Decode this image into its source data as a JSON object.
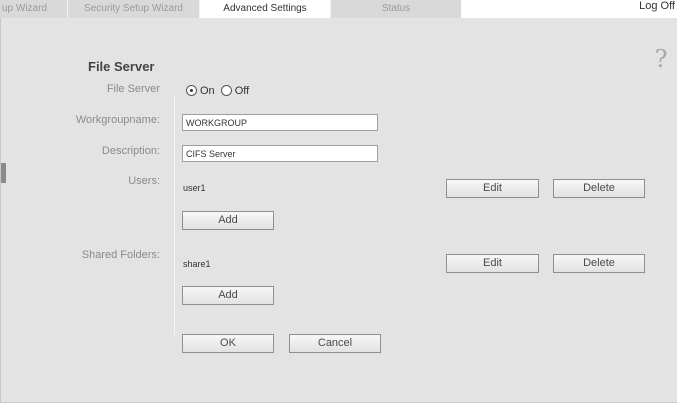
{
  "tabs": [
    {
      "label": "up Wizard",
      "active": false
    },
    {
      "label": "Security Setup Wizard",
      "active": false
    },
    {
      "label": "Advanced Settings",
      "active": true
    },
    {
      "label": "Status",
      "active": false
    }
  ],
  "header": {
    "logoff_label": "Log Off",
    "help_icon": "help-question-icon",
    "help_glyph": "?"
  },
  "page": {
    "title": "File Server"
  },
  "form": {
    "file_server": {
      "label": "File Server",
      "options": [
        "On",
        "Off"
      ],
      "selected": "On"
    },
    "workgroup": {
      "label": "Workgroupname:",
      "value": "WORKGROUP"
    },
    "description": {
      "label": "Description:",
      "value": "CIFS Server"
    },
    "users": {
      "label": "Users:",
      "items": [
        {
          "name": "user1",
          "edit_label": "Edit",
          "delete_label": "Delete"
        }
      ],
      "add_label": "Add"
    },
    "shared_folders": {
      "label": "Shared Folders:",
      "items": [
        {
          "name": "share1",
          "edit_label": "Edit",
          "delete_label": "Delete"
        }
      ],
      "add_label": "Add"
    }
  },
  "actions": {
    "ok_label": "OK",
    "cancel_label": "Cancel"
  },
  "colors": {
    "panel_bg": "#e3e3e3",
    "tab_inactive_bg": "#d9d9d9",
    "tab_active_bg": "#ffffff",
    "label_text": "#8a8a8a"
  }
}
